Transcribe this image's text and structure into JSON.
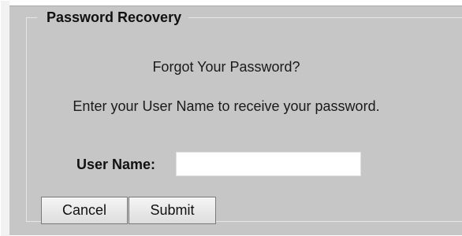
{
  "legend": "Password Recovery",
  "heading": "Forgot Your Password?",
  "instructions": "Enter your User Name to receive your password.",
  "username": {
    "label": "User Name:",
    "value": "",
    "placeholder": ""
  },
  "buttons": {
    "cancel": "Cancel",
    "submit": "Submit"
  },
  "colors": {
    "panel_background": "#c6c6c6",
    "fieldset_border": "#e6e6e6",
    "input_background": "#ffffff"
  }
}
